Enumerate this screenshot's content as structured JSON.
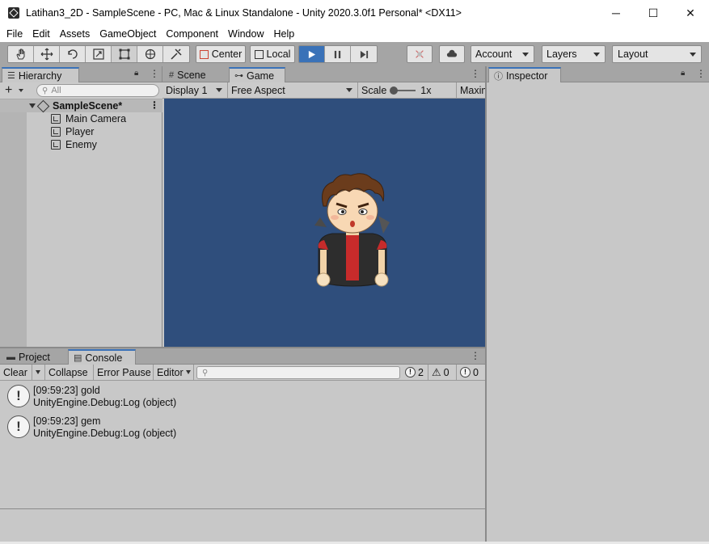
{
  "window": {
    "title": "Latihan3_2D - SampleScene - PC, Mac & Linux Standalone - Unity 2020.3.0f1 Personal* <DX11>",
    "minimize": "─",
    "maximize": "☐",
    "close": "✕"
  },
  "menu": [
    "File",
    "Edit",
    "Assets",
    "GameObject",
    "Component",
    "Window",
    "Help"
  ],
  "toolbar": {
    "tools": [
      "hand-tool",
      "move-tool",
      "rotate-tool",
      "scale-tool",
      "rect-tool",
      "transform-tool",
      "custom-tool"
    ],
    "pivot_mode": "Center",
    "pivot_rotation": "Local",
    "account": "Account",
    "layers": "Layers",
    "layout": "Layout"
  },
  "hierarchy": {
    "tab": "Hierarchy",
    "add": "+",
    "search_placeholder": "All",
    "scene": "SampleScene*",
    "objects": [
      "Main Camera",
      "Player",
      "Enemy"
    ]
  },
  "game_view": {
    "tabs": [
      "Scene",
      "Game"
    ],
    "active_tab": "Game",
    "display": "Display 1",
    "aspect": "Free Aspect",
    "scale_label": "Scale",
    "scale_value": "1x",
    "maximize": "Maximi",
    "background_color": "#2f4e7c"
  },
  "inspector": {
    "tab": "Inspector"
  },
  "console": {
    "tabs": [
      "Project",
      "Console"
    ],
    "active_tab": "Console",
    "clear": "Clear",
    "collapse": "Collapse",
    "error_pause": "Error Pause",
    "editor": "Editor",
    "log_count": "2",
    "warn_count": "0",
    "error_count": "0",
    "entries": [
      {
        "line1": "[09:59:23] gold",
        "line2": "UnityEngine.Debug:Log (object)"
      },
      {
        "line1": "[09:59:23] gem",
        "line2": "UnityEngine.Debug:Log (object)"
      }
    ]
  },
  "colors": {
    "accent": "#3a72b8",
    "panel": "#c8c8c8",
    "toolbar": "#a5a5a5"
  }
}
